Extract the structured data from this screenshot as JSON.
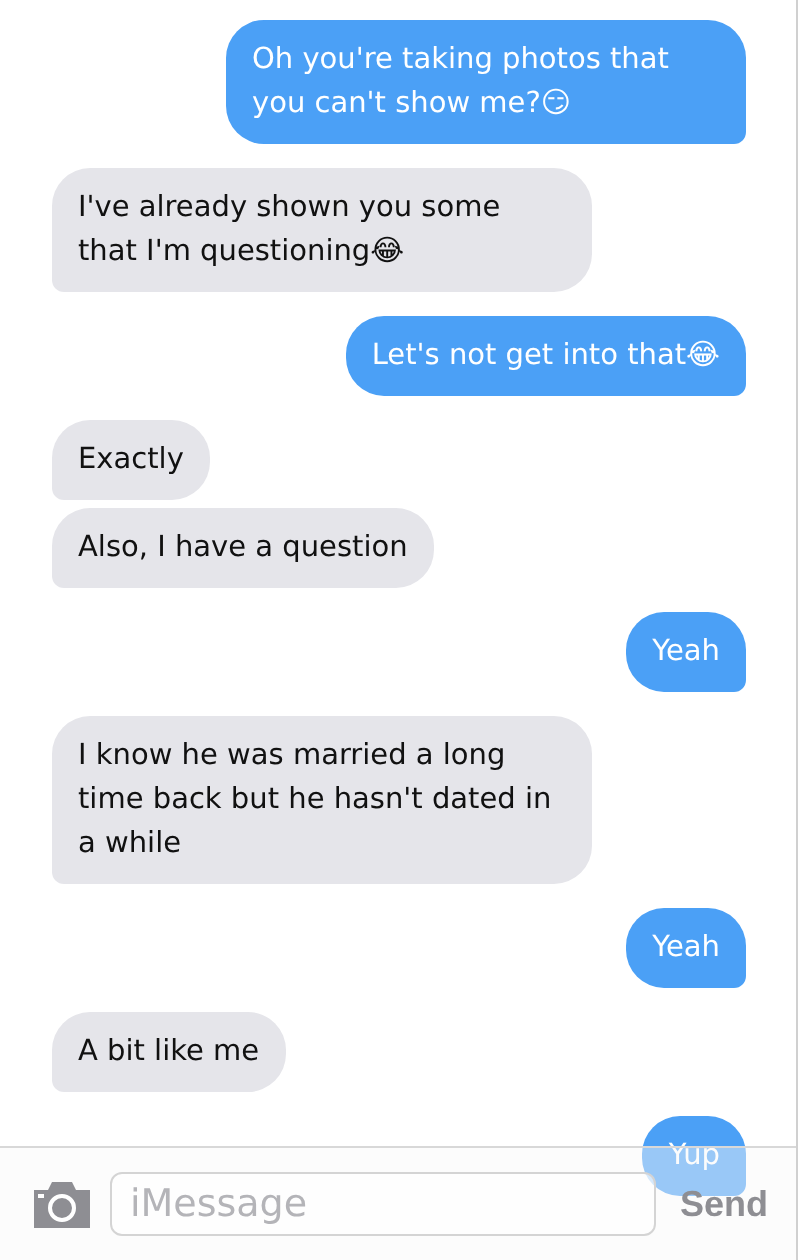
{
  "messages": [
    {
      "kind": "sent",
      "text": "Oh you're taking photos that you can't show me?😏"
    },
    {
      "kind": "received",
      "text": "I've already shown you some that I'm questioning😂"
    },
    {
      "kind": "sent",
      "text": "Let's not get into that😂"
    },
    {
      "kind": "received",
      "text": "Exactly"
    },
    {
      "kind": "received",
      "text": "Also, I have a question"
    },
    {
      "kind": "sent",
      "text": "Yeah"
    },
    {
      "kind": "received",
      "text": "I know he was married a long time back but he hasn't dated in a while"
    },
    {
      "kind": "sent",
      "text": "Yeah"
    },
    {
      "kind": "received",
      "text": "A bit like me"
    },
    {
      "kind": "sent",
      "text": "Yup"
    }
  ],
  "composer": {
    "placeholder": "iMessage",
    "send_label": "Send"
  }
}
